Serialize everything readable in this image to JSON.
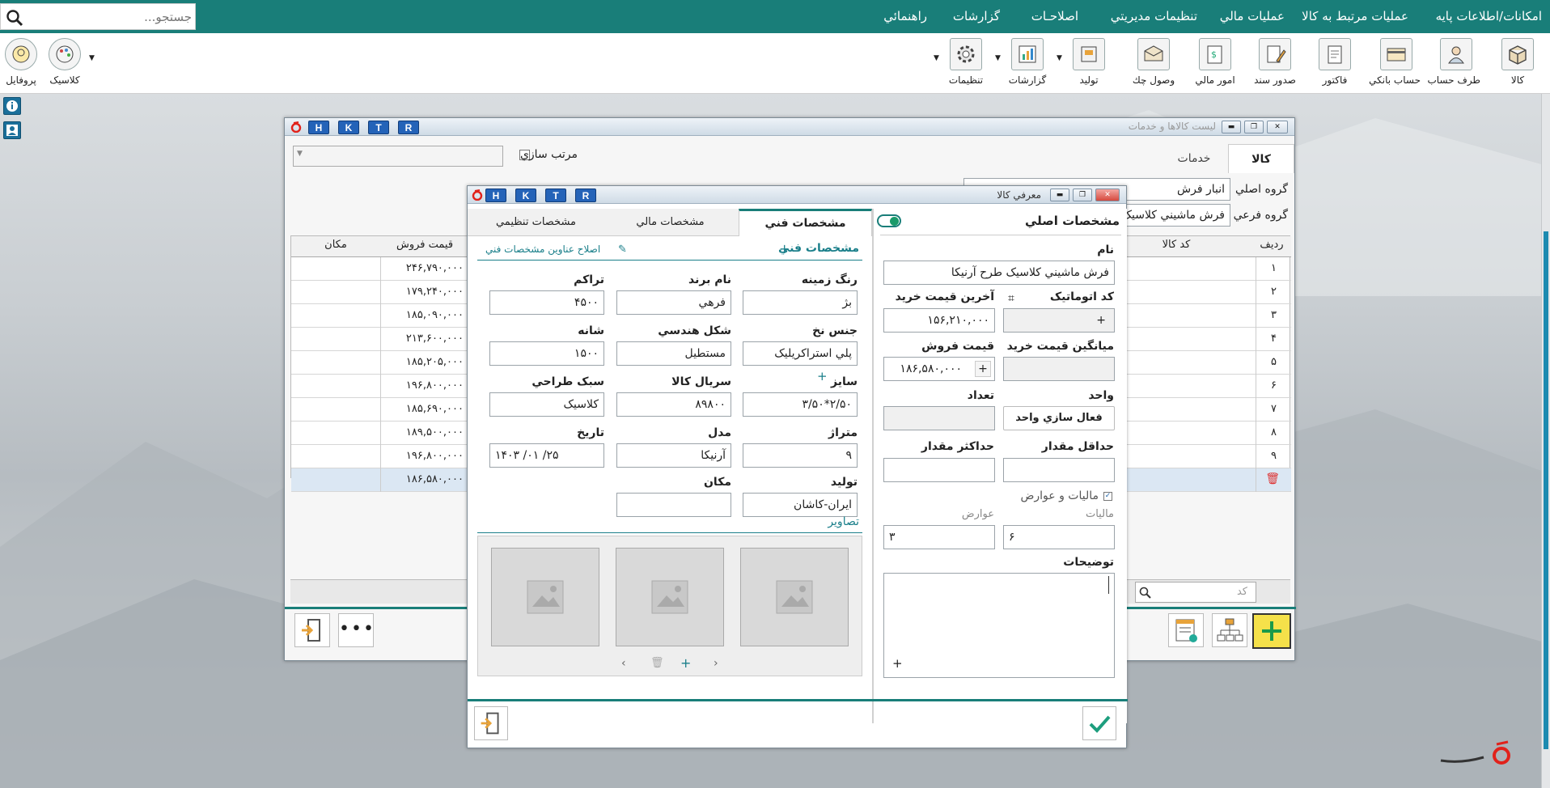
{
  "menubar": {
    "search_placeholder": "جستجو...",
    "items": [
      "امکانات/اطلاعات پايه",
      "عمليات مرتبط به کالا",
      "عمليات مالي",
      "تنظيمات مديريتي",
      "اصلاحـات",
      "گزارشات",
      "راهنمائي"
    ]
  },
  "toolbar": {
    "items": [
      {
        "label": "کالا",
        "icon": "box-icon"
      },
      {
        "label": "طرف حساب",
        "icon": "user-icon"
      },
      {
        "label": "حساب بانکي",
        "icon": "bank-card-icon"
      },
      {
        "label": "فاکتور",
        "icon": "invoice-icon"
      },
      {
        "label": "صدور سند",
        "icon": "document-pen-icon"
      },
      {
        "label": "امور مالي",
        "icon": "money-doc-icon"
      },
      {
        "label": "وصول چك",
        "icon": "cheque-icon"
      },
      {
        "label": "توليد",
        "icon": "production-icon"
      },
      {
        "label": "گزارشات",
        "icon": "chart-report-icon"
      },
      {
        "label": "تنظيمات",
        "icon": "gear-icon"
      }
    ],
    "left_items": [
      {
        "label": "کلاسيک",
        "icon": "palette-icon"
      },
      {
        "label": "پروفايل",
        "icon": "profile-icon"
      }
    ]
  },
  "hktr": [
    "H",
    "K",
    "T",
    "R"
  ],
  "list_window": {
    "title": "ليست کالاها و خدمات",
    "tabs": [
      "کالا",
      "خدمات"
    ],
    "sort_label": "مرتب سازي",
    "main_group_label": "گروه اصلي",
    "main_group_value": "انبار فرش",
    "sub_group_label": "گروه فرعي",
    "sub_group_value": "فرش ماشيني کلاسيک",
    "col_row": "رديف",
    "col_code": "کد کالا",
    "col_price": "قيمت فروش",
    "col_place": "مکان",
    "rows": [
      {
        "n": "۱",
        "price": "۲۴۶,۷۹۰,۰۰۰"
      },
      {
        "n": "۲",
        "price": "۱۷۹,۲۴۰,۰۰۰"
      },
      {
        "n": "۳",
        "price": "۱۸۵,۰۹۰,۰۰۰"
      },
      {
        "n": "۴",
        "price": "۲۱۳,۶۰۰,۰۰۰"
      },
      {
        "n": "۵",
        "price": "۱۸۵,۲۰۵,۰۰۰"
      },
      {
        "n": "۶",
        "price": "۱۹۶,۸۰۰,۰۰۰"
      },
      {
        "n": "۷",
        "price": "۱۸۵,۶۹۰,۰۰۰"
      },
      {
        "n": "۸",
        "price": "۱۸۹,۵۰۰,۰۰۰"
      },
      {
        "n": "۹",
        "price": "۱۹۶,۸۰۰,۰۰۰"
      },
      {
        "n": "",
        "price": "۱۸۶,۵۸۰,۰۰۰"
      }
    ],
    "code_search_placeholder": "کد"
  },
  "dialog": {
    "title": "معرفي کالا",
    "main_section": "مشخصات اصلي",
    "tabs": [
      "مشخصات فني",
      "مشخصات مالي",
      "مشخصات تنظيمي"
    ],
    "name_label": "نام",
    "name_value": "فرش ماشيني کلاسيک طرح آرنيکا",
    "auto_code_label": "کد اتوماتيک",
    "last_buy_label": "آخرين قيمت خريد",
    "last_buy_value": "۱۵۶,۲۱۰,۰۰۰",
    "avg_buy_label": "ميانگين قيمت خريد",
    "sell_price_label": "قيمت فروش",
    "sell_price_value": "۱۸۶,۵۸۰,۰۰۰",
    "unit_label": "واحد",
    "unit_button": "فعال سازي واحد",
    "count_label": "تعداد",
    "min_label": "حداقل مقدار",
    "max_label": "حداکثر مقدار",
    "tax_check_label": "ماليات و عوارض",
    "tax_label": "ماليات",
    "tax_value": "۶",
    "duty_label": "عوارض",
    "duty_value": "۳",
    "desc_label": "توضيحات",
    "tech_header": "مشخصات فني",
    "edit_titles": "اصلاح عناوين مشخصات فني",
    "tech_fields": [
      {
        "label": "رنگ زمينه",
        "value": "بژ"
      },
      {
        "label": "نام برند",
        "value": "فرهي"
      },
      {
        "label": "تراکم",
        "value": "۴۵۰۰"
      },
      {
        "label": "جنس نخ",
        "value": "پلي استراکريلیک"
      },
      {
        "label": "شکل هندسي",
        "value": "مستطيل"
      },
      {
        "label": "شانه",
        "value": "۱۵۰۰"
      },
      {
        "label": "سايز",
        "value": "۲/۵۰*۳/۵۰"
      },
      {
        "label": "سريال کالا",
        "value": "۸۹۸۰۰"
      },
      {
        "label": "سبک طراحي",
        "value": "کلاسيک"
      },
      {
        "label": "متراژ",
        "value": "۹"
      },
      {
        "label": "مدل",
        "value": "آرنيکا"
      },
      {
        "label": "تاريخ",
        "value": "۱۴۰۳    /۰۱    /۲۵"
      },
      {
        "label": "توليد",
        "value": "ايران-کاشان"
      },
      {
        "label": "مکان",
        "value": ""
      }
    ],
    "images_label": "تصاوير"
  },
  "colors": {
    "teal": "#197e79",
    "hktr": "#2463b8",
    "confirm": "#1d9e7e"
  }
}
